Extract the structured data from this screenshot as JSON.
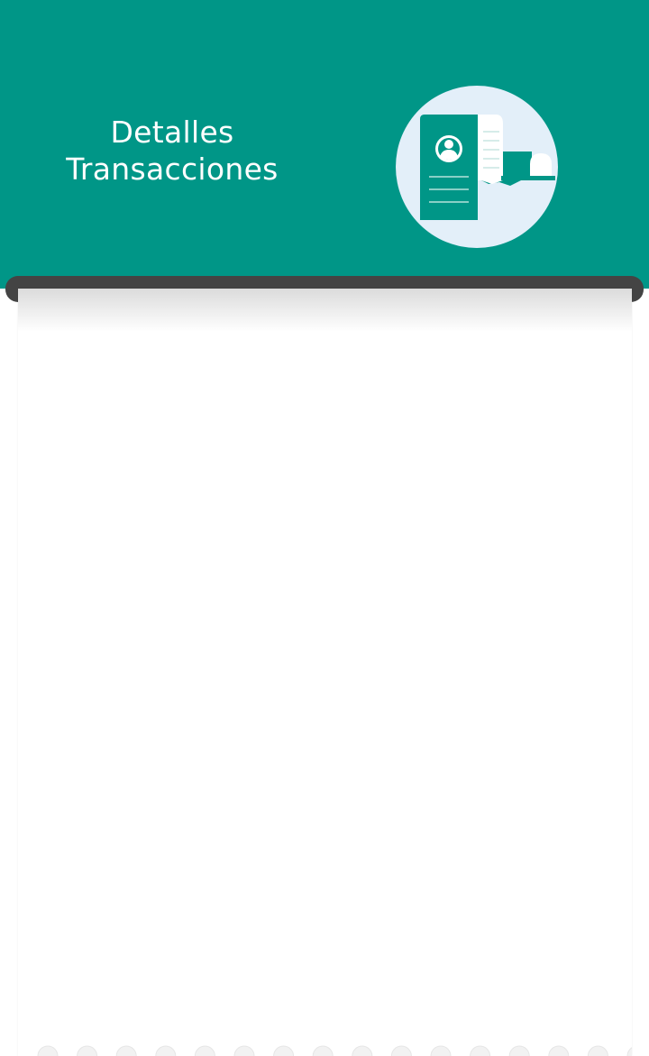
{
  "header": {
    "title_line1": "Detalles",
    "title_line2": "Transacciones",
    "illustration_icon": "receipt-document-icon"
  },
  "colors": {
    "header_bg": "#009687",
    "printer_slot": "#444444",
    "illustration_circle": "#e3eff9",
    "receipt_bg": "#ffffff"
  }
}
